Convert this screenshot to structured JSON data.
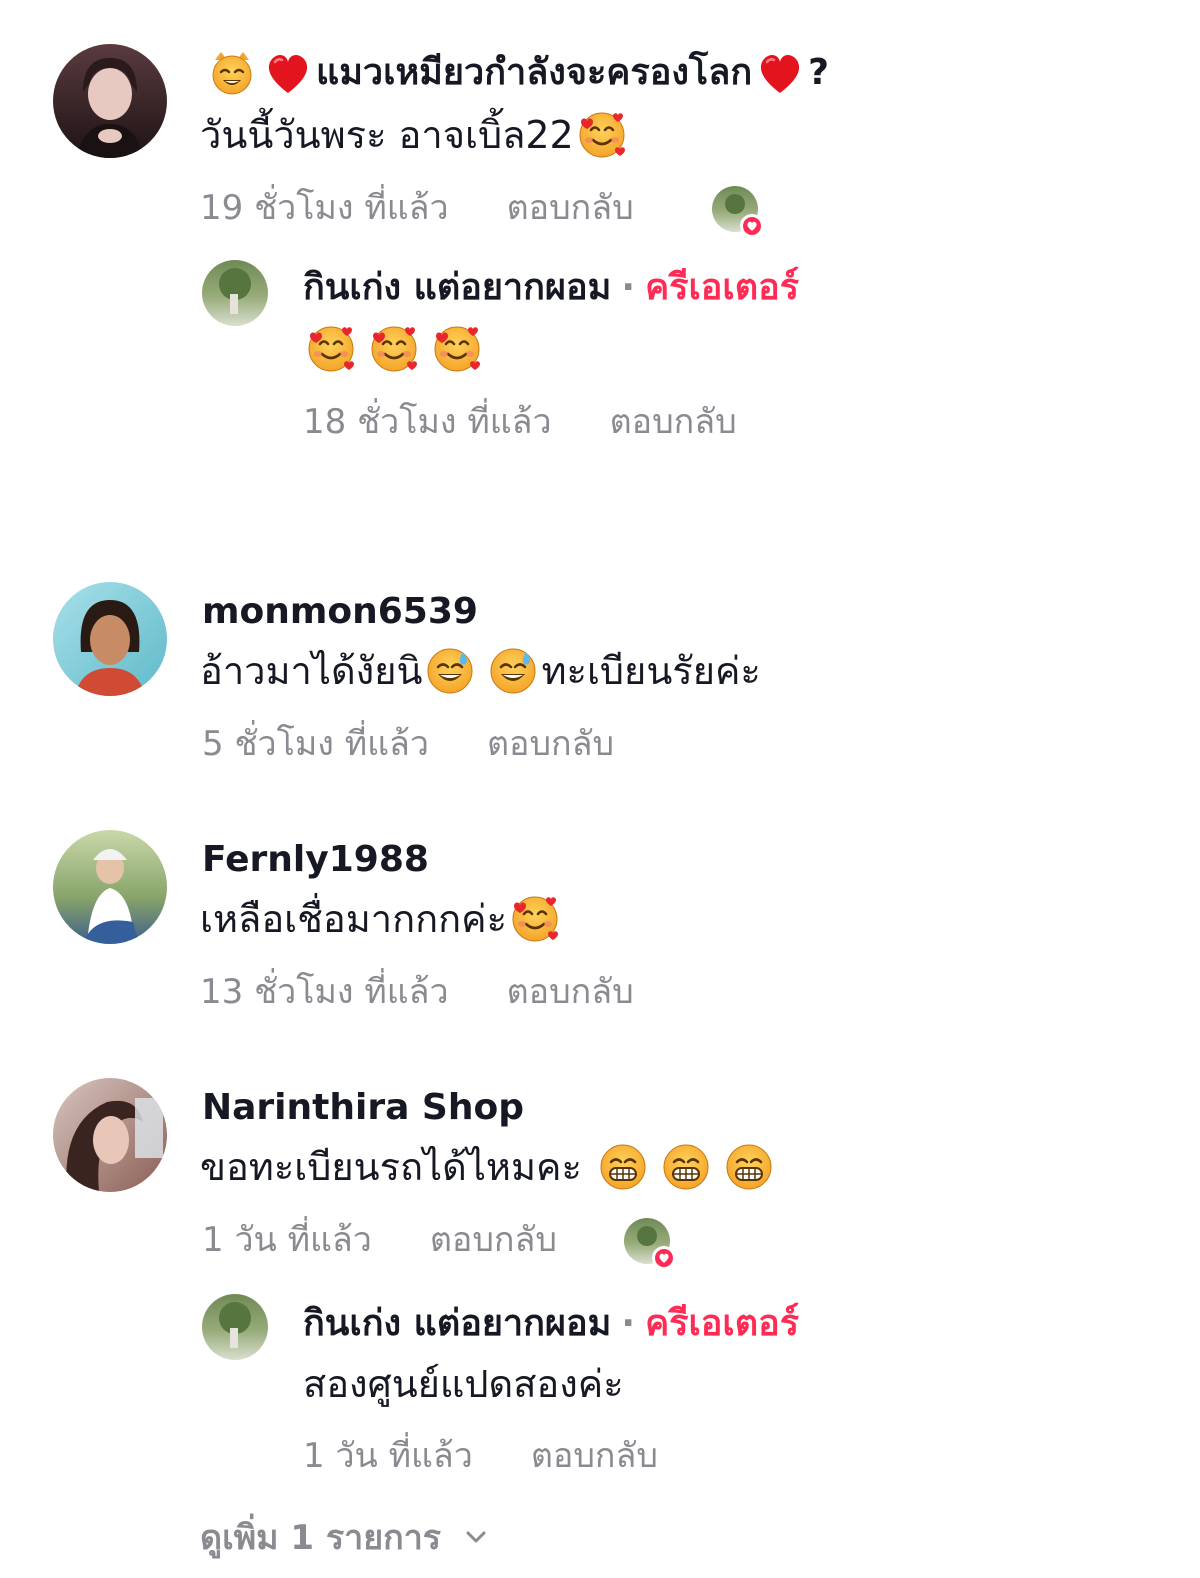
{
  "comments": [
    {
      "id": "c1",
      "username_parts": [
        "แมวเหมียวกำลังจะครองโลก",
        "?"
      ],
      "text": "วันนี้วันพระ อาจเบิ้ล22",
      "time": "19 ชั่วโมง ที่แล้ว",
      "reply_label": "ตอบกลับ",
      "liked_by_creator": true,
      "replies": [
        {
          "username": "กินเก่ง แต่อยากผอม",
          "separator": "·",
          "badge": "ครีเอเตอร์",
          "text": "",
          "time": "18 ชั่วโมง ที่แล้ว",
          "reply_label": "ตอบกลับ"
        }
      ]
    },
    {
      "id": "c2",
      "username": "monmon6539",
      "text_before": "อ้าวมาได้งัยนิ",
      "text_after": "ทะเบียนรัยค่ะ",
      "time": "5 ชั่วโมง ที่แล้ว",
      "reply_label": "ตอบกลับ"
    },
    {
      "id": "c3",
      "username": "Fernly1988",
      "text": "เหลือเชื่อมากกกค่ะ",
      "time": "13 ชั่วโมง ที่แล้ว",
      "reply_label": "ตอบกลับ"
    },
    {
      "id": "c4",
      "username": "Narinthira Shop",
      "text": "ขอทะเบียนรถได้ไหมคะ",
      "time": "1 วัน ที่แล้ว",
      "reply_label": "ตอบกลับ",
      "liked_by_creator": true,
      "replies": [
        {
          "username": "กินเก่ง แต่อยากผอม",
          "separator": "·",
          "badge": "ครีเอเตอร์",
          "text": "สองศูนย์แปดสองค่ะ",
          "time": "1 วัน ที่แล้ว",
          "reply_label": "ตอบกลับ"
        }
      ]
    }
  ],
  "view_more": {
    "label": "ดูเพิ่ม 1 รายการ",
    "icon": "chevron-down-icon"
  },
  "colors": {
    "creator": "#fe2c55",
    "meta": "#8a8b91",
    "text": "#161823"
  },
  "icons": {
    "emoji_heart_eyes": "smiling-face-with-hearts-icon",
    "emoji_sweat": "grinning-sweat-icon",
    "emoji_grin": "grimacing-grin-icon",
    "emoji_cat": "cat-face-icon",
    "emoji_heart": "red-heart-icon"
  }
}
